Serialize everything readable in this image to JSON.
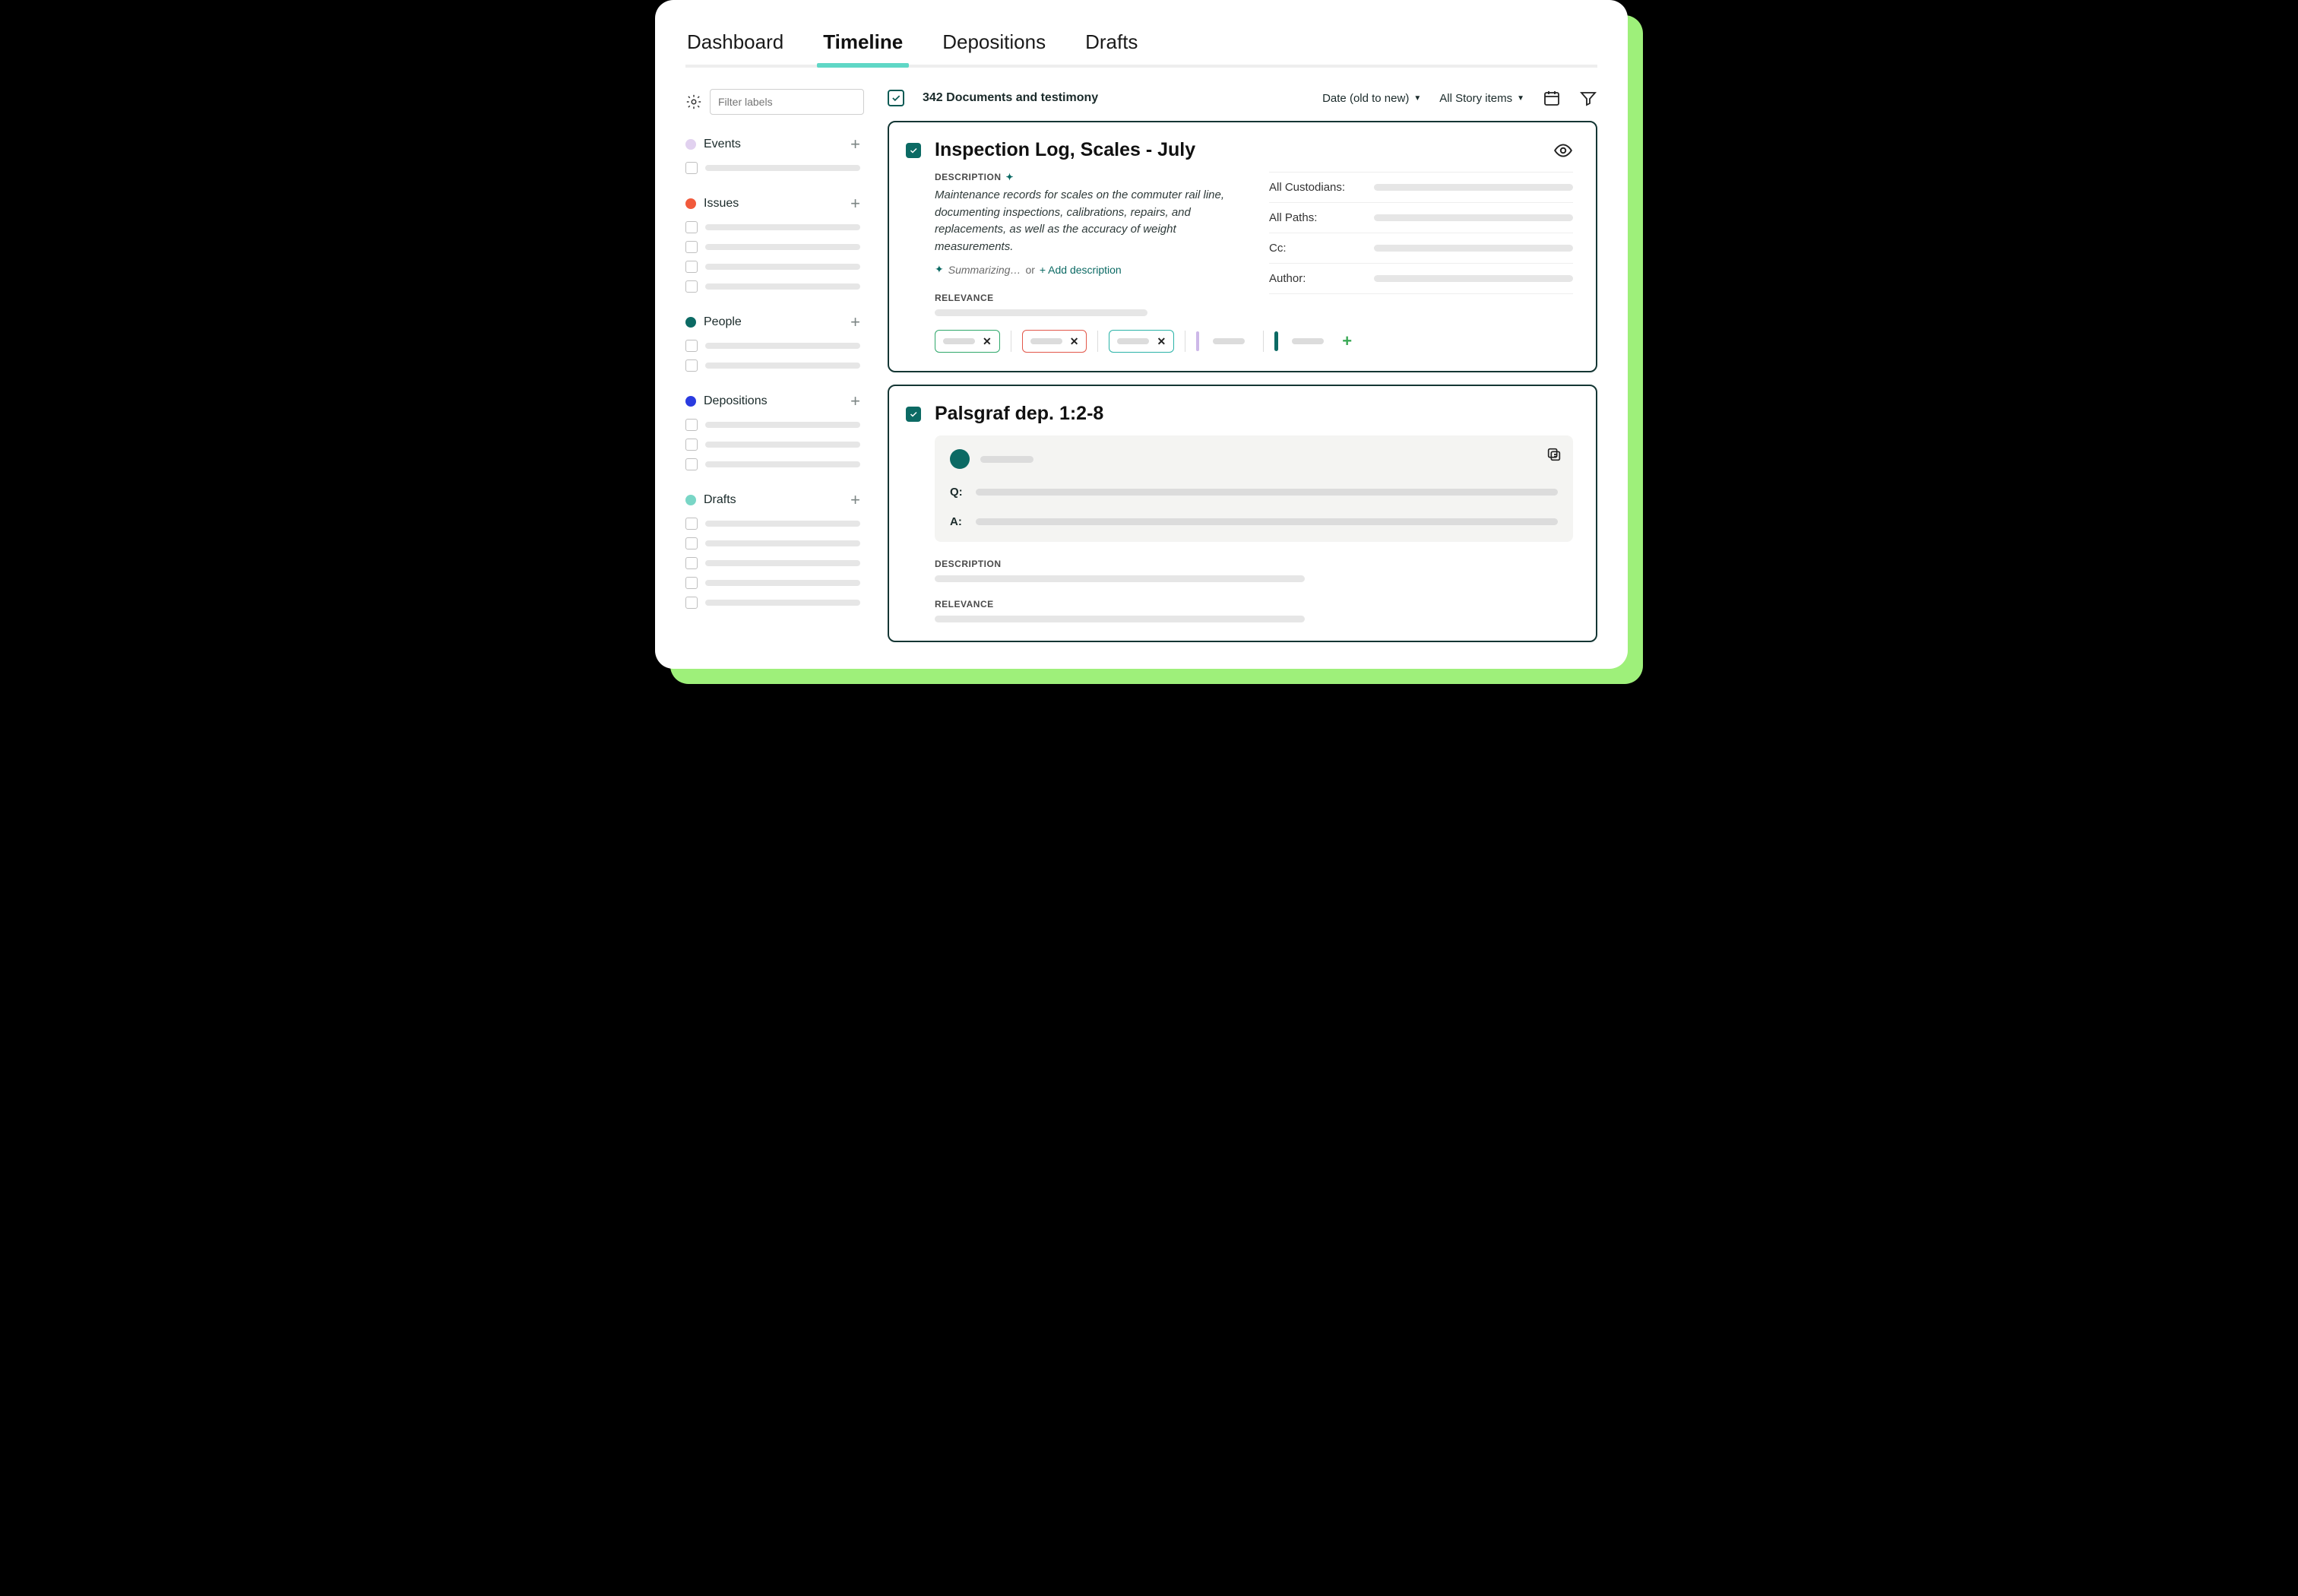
{
  "tabs": [
    "Dashboard",
    "Timeline",
    "Depositions",
    "Drafts"
  ],
  "active_tab": "Timeline",
  "sidebar": {
    "filter_placeholder": "Filter labels",
    "groups": [
      {
        "name": "Events",
        "color": "#e1d1ef",
        "items": 1
      },
      {
        "name": "Issues",
        "color": "#f15a3c",
        "items": 4
      },
      {
        "name": "People",
        "color": "#0c6a64",
        "items": 2
      },
      {
        "name": "Depositions",
        "color": "#2a3be0",
        "items": 3
      },
      {
        "name": "Drafts",
        "color": "#79d6c6",
        "items": 5
      }
    ]
  },
  "toolbar": {
    "count_text": "342 Documents and testimony",
    "sort_label": "Date (old to new)",
    "scope_label": "All Story items"
  },
  "cards": [
    {
      "title": "Inspection Log, Scales - July",
      "description_heading": "DESCRIPTION",
      "description": "Maintenance records for scales on the commuter rail line, documenting inspections, calibrations, repairs, and replacements, as well as the accuracy of weight measurements.",
      "summarizing_label": "Summarizing…",
      "or_label": " or ",
      "add_description_label": "+ Add description",
      "relevance_heading": "RELEVANCE",
      "meta": [
        {
          "label": "All Custodians:"
        },
        {
          "label": "All Paths:"
        },
        {
          "label": "Cc:"
        },
        {
          "label": "Author:"
        }
      ]
    },
    {
      "title": "Palsgraf dep. 1:2-8",
      "q_label": "Q:",
      "a_label": "A:",
      "description_heading": "DESCRIPTION",
      "relevance_heading": "RELEVANCE"
    }
  ]
}
